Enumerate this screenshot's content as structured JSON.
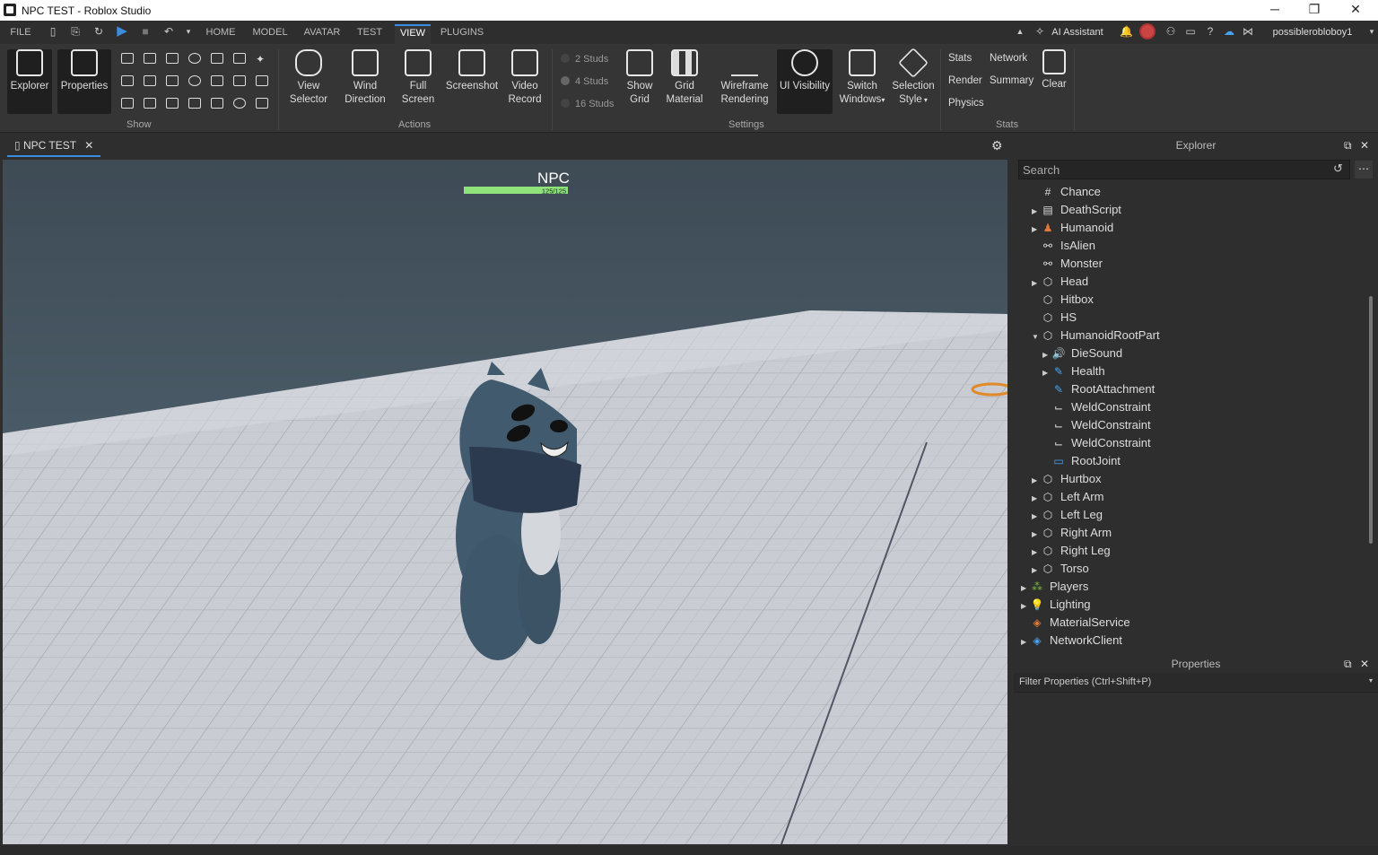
{
  "window": {
    "title": "NPC TEST - Roblox Studio",
    "minimize": "─",
    "maximize": "❐",
    "close": "✕"
  },
  "menu": {
    "file": "FILE",
    "tabs": [
      "HOME",
      "MODEL",
      "AVATAR",
      "TEST",
      "VIEW",
      "PLUGINS"
    ],
    "active_tab": "VIEW",
    "ai_assistant": "AI Assistant",
    "username": "possiblerobloboy1"
  },
  "ribbon": {
    "show": {
      "explorer": "Explorer",
      "properties": "Properties",
      "label": "Show"
    },
    "actions": {
      "view_selector": [
        "View",
        "Selector"
      ],
      "wind_direction": [
        "Wind",
        "Direction"
      ],
      "full_screen": [
        "Full",
        "Screen"
      ],
      "screenshot": "Screenshot",
      "video_record": [
        "Video",
        "Record"
      ],
      "label": "Actions"
    },
    "settings": {
      "studs": [
        "2 Studs",
        "4 Studs",
        "16 Studs"
      ],
      "show_grid": [
        "Show",
        "Grid"
      ],
      "grid_material": [
        "Grid",
        "Material"
      ],
      "wireframe": [
        "Wireframe",
        "Rendering"
      ],
      "ui_visibility": "UI Visibility",
      "switch_windows": [
        "Switch",
        "Windows"
      ],
      "selection_style": [
        "Selection",
        "Style"
      ],
      "label": "Settings"
    },
    "stats": {
      "items": [
        "Stats",
        "Network",
        "Render",
        "Summary",
        "Physics"
      ],
      "clear": "Clear",
      "label": "Stats"
    }
  },
  "doc_tab": {
    "title": "NPC TEST",
    "close": "✕"
  },
  "viewport": {
    "npc_name": "NPC",
    "health_text": "125/125",
    "health_fraction": 1.0
  },
  "explorer": {
    "title": "Explorer",
    "search_placeholder": "Search",
    "items": [
      {
        "label": "Chance",
        "icon": "#",
        "color": "#ddd"
      },
      {
        "label": "DeathScript",
        "icon": "▤",
        "color": "#ddd"
      },
      {
        "label": "Humanoid",
        "icon": "♟",
        "color": "#e07a3a"
      },
      {
        "label": "IsAlien",
        "icon": "⚯",
        "color": "#ddd"
      },
      {
        "label": "Monster",
        "icon": "⚯",
        "color": "#ddd"
      },
      {
        "label": "Head",
        "icon": "⬡",
        "color": "#ddd"
      },
      {
        "label": "Hitbox",
        "icon": "⬡",
        "color": "#ddd"
      },
      {
        "label": "HS",
        "icon": "⬡",
        "color": "#ddd"
      },
      {
        "label": "HumanoidRootPart",
        "icon": "⬡",
        "color": "#ddd"
      },
      {
        "label": "DieSound",
        "icon": "🔊",
        "color": "#e07a3a"
      },
      {
        "label": "Health",
        "icon": "✎",
        "color": "#4aa3f0"
      },
      {
        "label": "RootAttachment",
        "icon": "✎",
        "color": "#4aa3f0"
      },
      {
        "label": "WeldConstraint",
        "icon": "⌙",
        "color": "#ddd"
      },
      {
        "label": "WeldConstraint",
        "icon": "⌙",
        "color": "#ddd"
      },
      {
        "label": "WeldConstraint",
        "icon": "⌙",
        "color": "#ddd"
      },
      {
        "label": "RootJoint",
        "icon": "▭",
        "color": "#4aa3f0"
      },
      {
        "label": "Hurtbox",
        "icon": "⬡",
        "color": "#ddd"
      },
      {
        "label": "Left Arm",
        "icon": "⬡",
        "color": "#ddd"
      },
      {
        "label": "Left Leg",
        "icon": "⬡",
        "color": "#ddd"
      },
      {
        "label": "Right Arm",
        "icon": "⬡",
        "color": "#ddd"
      },
      {
        "label": "Right Leg",
        "icon": "⬡",
        "color": "#ddd"
      },
      {
        "label": "Torso",
        "icon": "⬡",
        "color": "#ddd"
      },
      {
        "label": "Players",
        "icon": "⁂",
        "color": "#7bc043"
      },
      {
        "label": "Lighting",
        "icon": "💡",
        "color": "#f2d34b"
      },
      {
        "label": "MaterialService",
        "icon": "◈",
        "color": "#e07a3a"
      },
      {
        "label": "NetworkClient",
        "icon": "◈",
        "color": "#4aa3f0"
      }
    ]
  },
  "properties": {
    "title": "Properties",
    "filter_placeholder": "Filter Properties (Ctrl+Shift+P)"
  },
  "colors": {
    "accent": "#3a8dde",
    "health": "#8fe37a"
  }
}
